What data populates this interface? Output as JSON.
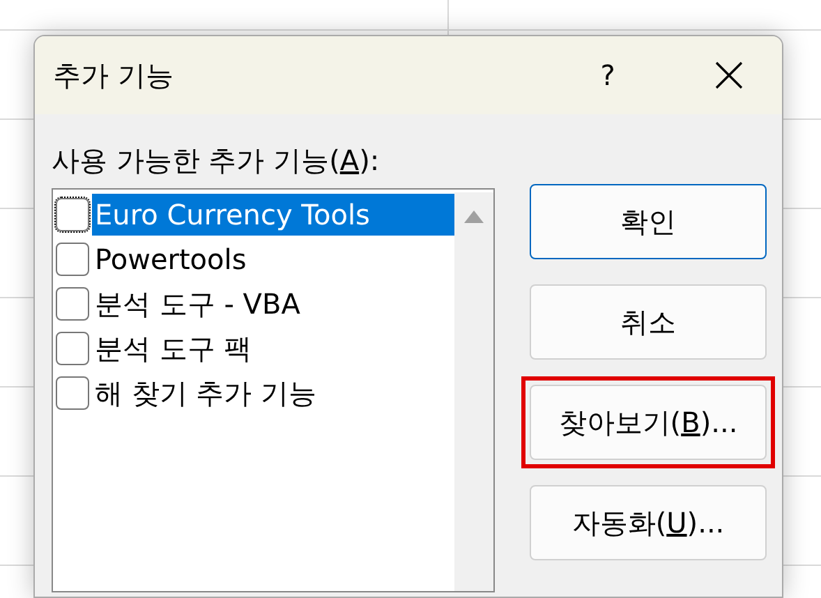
{
  "window": {
    "title": "추가 기능",
    "help": "?"
  },
  "list_label": {
    "before": "사용 가능한 추가 기능(",
    "access_key": "A",
    "after": "):"
  },
  "addins": [
    {
      "label": "Euro Currency Tools",
      "checked": false,
      "selected": true
    },
    {
      "label": "Powertools",
      "checked": false,
      "selected": false
    },
    {
      "label": "분석 도구 - VBA",
      "checked": false,
      "selected": false
    },
    {
      "label": "분석 도구 팩",
      "checked": false,
      "selected": false
    },
    {
      "label": "해 찾기 추가 기능",
      "checked": false,
      "selected": false
    }
  ],
  "buttons": [
    {
      "before": "확인",
      "default": true,
      "highlighted": false
    },
    {
      "before": "취소",
      "default": false,
      "highlighted": false
    },
    {
      "before": "찾아보기(",
      "access_key": "B",
      "after": ")...",
      "default": false,
      "highlighted": true
    },
    {
      "before": "자동화(",
      "access_key": "U",
      "after": ")...",
      "default": false,
      "highlighted": false
    }
  ]
}
